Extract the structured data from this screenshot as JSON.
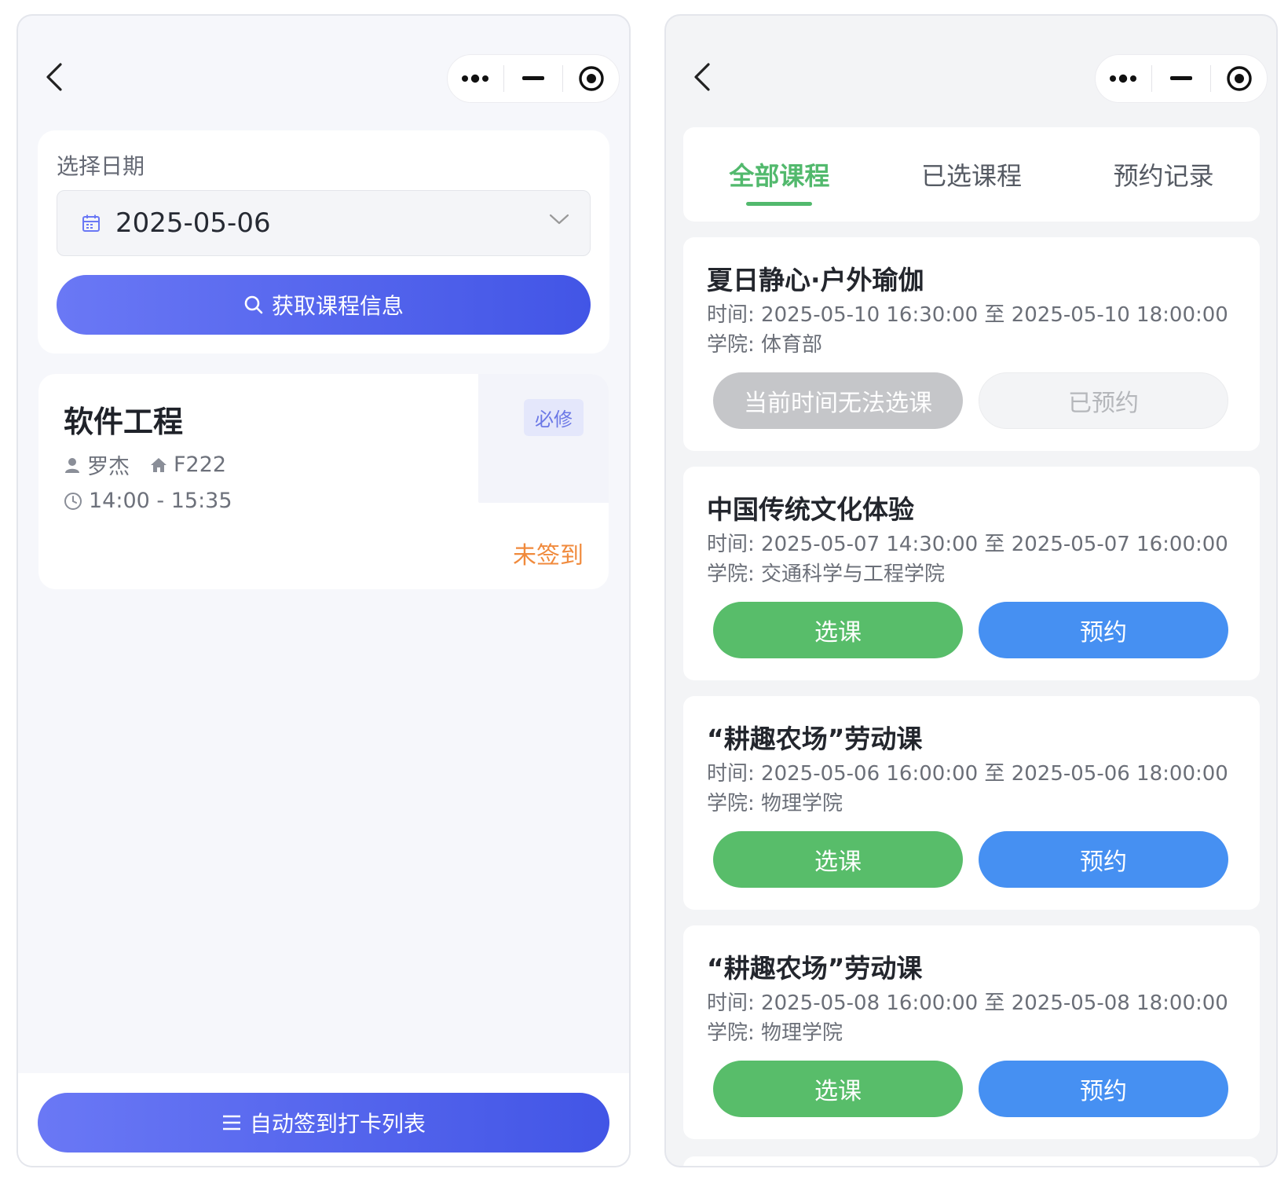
{
  "left": {
    "date_card": {
      "label": "选择日期",
      "date_value": "2025-05-06",
      "fetch_button": "获取课程信息"
    },
    "course": {
      "title": "软件工程",
      "tag": "必修",
      "teacher": "罗杰",
      "room": "F222",
      "time": "14:00 - 15:35",
      "status": "未签到"
    },
    "bottom_button": "自动签到打卡列表"
  },
  "right": {
    "tabs": [
      "全部课程",
      "已选课程",
      "预约记录"
    ],
    "active_tab": 0,
    "courses": [
      {
        "title": "夏日静心·户外瑜伽",
        "time": "时间: 2025-05-10 16:30:00 至 2025-05-10 18:00:00",
        "college": "学院: 体育部",
        "select_label": "当前时间无法选课",
        "reserve_label": "已预约",
        "disabled": true
      },
      {
        "title": "中国传统文化体验",
        "time": "时间: 2025-05-07 14:30:00 至 2025-05-07 16:00:00",
        "college": "学院: 交通科学与工程学院",
        "select_label": "选课",
        "reserve_label": "预约",
        "disabled": false
      },
      {
        "title": "“耕趣农场”劳动课",
        "time": "时间: 2025-05-06 16:00:00 至 2025-05-06 18:00:00",
        "college": "学院: 物理学院",
        "select_label": "选课",
        "reserve_label": "预约",
        "disabled": false
      },
      {
        "title": "“耕趣农场”劳动课",
        "time": "时间: 2025-05-08 16:00:00 至 2025-05-08 18:00:00",
        "college": "学院: 物理学院",
        "select_label": "选课",
        "reserve_label": "预约",
        "disabled": false
      }
    ]
  },
  "colors": {
    "primary_gradient_start": "#6a78f5",
    "primary_gradient_end": "#4255e6",
    "select_green": "#58bd6a",
    "reserve_blue": "#4690f2",
    "status_orange": "#f08a3c",
    "tab_active_green": "#52b96d"
  },
  "icons": [
    "back-arrow-icon",
    "more-dots-icon",
    "minimize-icon",
    "target-icon",
    "calendar-icon",
    "chevron-down-icon",
    "search-icon",
    "user-icon",
    "home-icon",
    "clock-icon",
    "menu-icon"
  ]
}
